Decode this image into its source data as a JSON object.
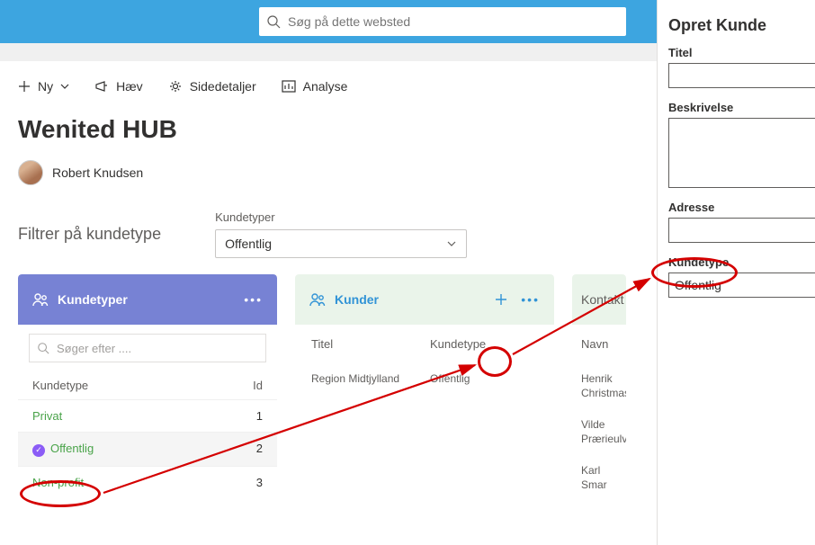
{
  "search": {
    "placeholder": "Søg på dette websted"
  },
  "toolbar": {
    "new": "Ny",
    "raise": "Hæv",
    "details": "Sidedetaljer",
    "analyse": "Analyse"
  },
  "page_title": "Wenited HUB",
  "user": {
    "name": "Robert Knudsen"
  },
  "filter": {
    "label": "Filtrer på kundetype",
    "dropdown_label": "Kundetyper",
    "dropdown_value": "Offentlig"
  },
  "kundetyper": {
    "header": "Kundetyper",
    "search_placeholder": "Søger efter ....",
    "col_type": "Kundetype",
    "col_id": "Id",
    "rows": [
      {
        "name": "Privat",
        "id": "1"
      },
      {
        "name": "Offentlig",
        "id": "2"
      },
      {
        "name": "Non-profit",
        "id": "3"
      }
    ]
  },
  "kunder": {
    "header": "Kunder",
    "col_title": "Titel",
    "col_type": "Kundetype",
    "rows": [
      {
        "title": "Region Midtjylland",
        "type": "Offentlig"
      }
    ]
  },
  "kontakter": {
    "header": "Kontakt",
    "col_name": "Navn",
    "rows": [
      "Henrik Christmas",
      "Vilde Prærieulv",
      "Karl Smar"
    ]
  },
  "panel": {
    "title": "Opret Kunde",
    "fields": {
      "titel": "Titel",
      "beskrivelse": "Beskrivelse",
      "adresse": "Adresse",
      "kundetype": "Kundetype",
      "kundetype_value": "Offentlig"
    }
  }
}
